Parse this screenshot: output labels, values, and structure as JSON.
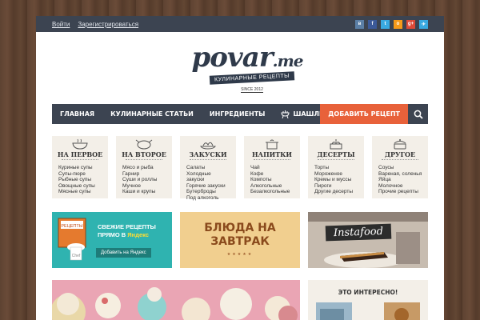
{
  "auth": {
    "login": "Войти",
    "register": "Зарегистрироваться"
  },
  "social": [
    {
      "icon": "vk-icon",
      "glyph": "в",
      "color": "#5b7fa6"
    },
    {
      "icon": "facebook-icon",
      "glyph": "f",
      "color": "#3b5998"
    },
    {
      "icon": "twitter-icon",
      "glyph": "t",
      "color": "#39a9e0"
    },
    {
      "icon": "odnoklassniki-icon",
      "glyph": "о",
      "color": "#f59a1a"
    },
    {
      "icon": "googleplus-icon",
      "glyph": "g+",
      "color": "#dc4a38"
    },
    {
      "icon": "paper-plane-icon",
      "glyph": "✈",
      "color": "#39a9e0"
    }
  ],
  "logo": {
    "word": "povar",
    "suffix": ".me",
    "tagline": "КУЛИНАРНЫЕ РЕЦЕПТЫ",
    "since": "SINCE 2012"
  },
  "nav": {
    "home": "ГЛАВНАЯ",
    "articles": "КУЛИНАРНЫЕ СТАТЬИ",
    "ingredients": "ИНГРЕДИЕНТЫ",
    "bbq": "ШАШЛЫК",
    "add_recipe": "ДОБАВИТЬ РЕЦЕПТ"
  },
  "categories": [
    {
      "title": "НА ПЕРВОЕ",
      "icon": "soup-bowl-icon",
      "items": [
        "Куриные супы",
        "Супы-пюре",
        "Рыбные супы",
        "Овощные супы",
        "Мясные супы"
      ]
    },
    {
      "title": "НА ВТОРОЕ",
      "icon": "roast-chicken-icon",
      "items": [
        "Мясо и рыба",
        "Гарнир",
        "Суши и роллы",
        "Мучное",
        "Каши и крупы"
      ]
    },
    {
      "title": "ЗАКУСКИ",
      "icon": "snack-icon",
      "items": [
        "Салаты",
        "Холодные",
        "закуски",
        "Горячие закуски",
        "Бутерброды",
        "Под алкоголь"
      ]
    },
    {
      "title": "НАПИТКИ",
      "icon": "pot-icon",
      "items": [
        "Чай",
        "Кофе",
        "Компоты",
        "Алкогольные",
        "Безалкогольные"
      ]
    },
    {
      "title": "ДЕСЕРТЫ",
      "icon": "cake-icon",
      "items": [
        "Торты",
        "Мороженое",
        "Кремы и муссы",
        "Пироги",
        "Другие десерты"
      ]
    },
    {
      "title": "ДРУГОЕ",
      "icon": "lidded-pot-icon",
      "items": [
        "Соусы",
        "Вареная, соленья",
        "Яйца",
        "Молочное",
        "Прочие рецепты"
      ]
    }
  ],
  "banners": {
    "yandex": {
      "line1": "СВЕЖИЕ РЕЦЕПТЫ",
      "line2": "ПРЯМО В",
      "brand": "Яндекс",
      "book_label": "РЕЦЕПТЫ",
      "chef_label": "Chef",
      "button": "Добавить на Яндекс"
    },
    "breakfast": {
      "line1": "БЛЮДА НА",
      "line2": "ЗАВТРАК",
      "stars": "★★★★★"
    },
    "instafood": {
      "label": "Instafood"
    }
  },
  "sidebar": {
    "title": "ЭТО ИНТЕРЕСНО!"
  },
  "colors": {
    "dark": "#3c4451",
    "accent": "#e8613a",
    "panel": "#f3efe8"
  }
}
